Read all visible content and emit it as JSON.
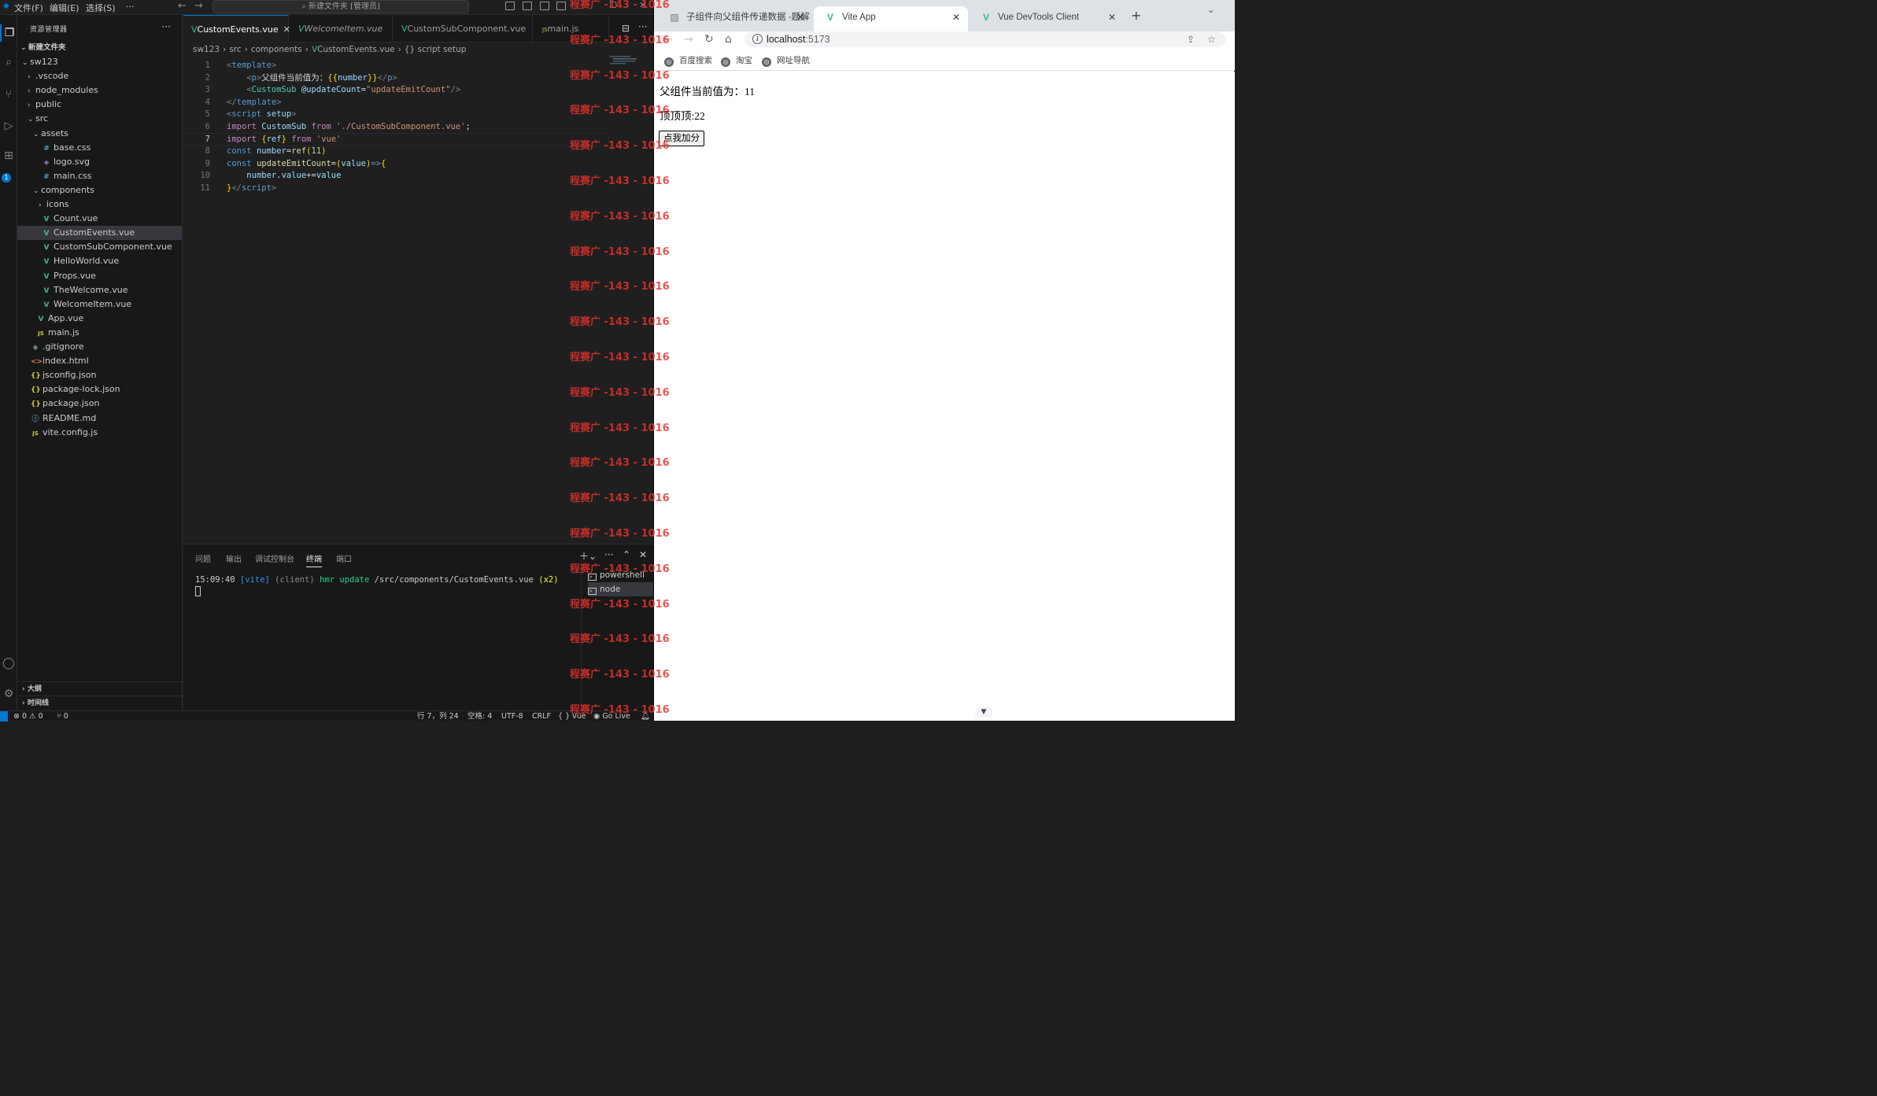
{
  "vscode": {
    "menu": [
      "文件(F)",
      "编辑(E)",
      "选择(S)",
      "···"
    ],
    "command_center": "新建文件夹 [管理员]",
    "sidebar": {
      "title": "资源管理器",
      "more": "···",
      "root": "新建文件夹",
      "tree": [
        {
          "label": "sw123",
          "type": "folder-open",
          "depth": 1
        },
        {
          "label": ".vscode",
          "type": "folder",
          "depth": 2
        },
        {
          "label": "node_modules",
          "type": "folder",
          "depth": 2
        },
        {
          "label": "public",
          "type": "folder",
          "depth": 2
        },
        {
          "label": "src",
          "type": "folder-open",
          "depth": 2
        },
        {
          "label": "assets",
          "type": "folder-open",
          "depth": 3
        },
        {
          "label": "base.css",
          "type": "css",
          "depth": 4
        },
        {
          "label": "logo.svg",
          "type": "svg",
          "depth": 4
        },
        {
          "label": "main.css",
          "type": "css",
          "depth": 4
        },
        {
          "label": "components",
          "type": "folder-open",
          "depth": 3
        },
        {
          "label": "icons",
          "type": "folder",
          "depth": 4
        },
        {
          "label": "Count.vue",
          "type": "vue",
          "depth": 4
        },
        {
          "label": "CustomEvents.vue",
          "type": "vue",
          "depth": 4,
          "selected": true
        },
        {
          "label": "CustomSubComponent.vue",
          "type": "vue",
          "depth": 4
        },
        {
          "label": "HelloWorld.vue",
          "type": "vue",
          "depth": 4
        },
        {
          "label": "Props.vue",
          "type": "vue",
          "depth": 4
        },
        {
          "label": "TheWelcome.vue",
          "type": "vue",
          "depth": 4
        },
        {
          "label": "WelcomeItem.vue",
          "type": "vue",
          "depth": 4
        },
        {
          "label": "App.vue",
          "type": "vue",
          "depth": 3
        },
        {
          "label": "main.js",
          "type": "js",
          "depth": 3
        },
        {
          "label": ".gitignore",
          "type": "git",
          "depth": 2
        },
        {
          "label": "index.html",
          "type": "html",
          "depth": 2
        },
        {
          "label": "jsconfig.json",
          "type": "json",
          "depth": 2
        },
        {
          "label": "package-lock.json",
          "type": "json",
          "depth": 2
        },
        {
          "label": "package.json",
          "type": "json",
          "depth": 2
        },
        {
          "label": "README.md",
          "type": "info",
          "depth": 2
        },
        {
          "label": "vite.config.js",
          "type": "js",
          "depth": 2
        }
      ],
      "outline": "大纲",
      "timeline": "时间线"
    },
    "activity_badge": "1",
    "tabs": [
      {
        "label": "CustomEvents.vue",
        "active": true,
        "close": "✕"
      },
      {
        "label": "WelcomeItem.vue",
        "italic": true
      },
      {
        "label": "CustomSubComponent.vue"
      },
      {
        "label": "main.js"
      }
    ],
    "breadcrumb": {
      "parts": [
        "sw123",
        "src",
        "components",
        "CustomEvents.vue",
        "{} script setup"
      ],
      "sep": "›"
    },
    "code_lines": [
      {
        "n": "1",
        "tokens": [
          [
            "k-punct",
            "<"
          ],
          [
            "k-tag",
            "template"
          ],
          [
            "k-punct",
            ">"
          ]
        ]
      },
      {
        "n": "2",
        "tokens": [
          [
            "k-plain",
            "    "
          ],
          [
            "k-punct",
            "<"
          ],
          [
            "k-tag",
            "p"
          ],
          [
            "k-punct",
            ">"
          ],
          [
            "k-text",
            "父组件当前值为："
          ],
          [
            "k-brace",
            "{{"
          ],
          [
            "k-var",
            "number"
          ],
          [
            "k-brace",
            "}}"
          ],
          [
            "k-punct",
            "</"
          ],
          [
            "k-tag",
            "p"
          ],
          [
            "k-punct",
            ">"
          ]
        ]
      },
      {
        "n": "3",
        "tokens": [
          [
            "k-plain",
            "    "
          ],
          [
            "k-punct",
            "<"
          ],
          [
            "k-tagname",
            "CustomSub"
          ],
          [
            "k-plain",
            " "
          ],
          [
            "k-attr",
            "@updateCount"
          ],
          [
            "k-plain",
            "="
          ],
          [
            "k-str",
            "\"updateEmitCount\""
          ],
          [
            "k-punct",
            "/>"
          ]
        ]
      },
      {
        "n": "4",
        "tokens": [
          [
            "k-punct",
            "</"
          ],
          [
            "k-tag",
            "template"
          ],
          [
            "k-punct",
            ">"
          ]
        ]
      },
      {
        "n": "5",
        "tokens": [
          [
            "k-punct",
            "<"
          ],
          [
            "k-tag",
            "script"
          ],
          [
            "k-plain",
            " "
          ],
          [
            "k-attr",
            "setup"
          ],
          [
            "k-punct",
            ">"
          ]
        ]
      },
      {
        "n": "6",
        "tokens": [
          [
            "k-kw",
            "import"
          ],
          [
            "k-plain",
            " "
          ],
          [
            "k-var",
            "CustomSub"
          ],
          [
            "k-plain",
            " "
          ],
          [
            "k-kw",
            "from"
          ],
          [
            "k-plain",
            " "
          ],
          [
            "k-str",
            "'./CustomSubComponent.vue'"
          ],
          [
            "k-plain",
            ";"
          ]
        ]
      },
      {
        "n": "7",
        "current": true,
        "tokens": [
          [
            "k-kw",
            "import"
          ],
          [
            "k-plain",
            " "
          ],
          [
            "k-brace",
            "{"
          ],
          [
            "k-var",
            "ref"
          ],
          [
            "k-brace",
            "}"
          ],
          [
            "k-plain",
            " "
          ],
          [
            "k-kw",
            "from"
          ],
          [
            "k-plain",
            " "
          ],
          [
            "k-str",
            "'vue'"
          ]
        ]
      },
      {
        "n": "8",
        "tokens": [
          [
            "k-decl",
            "const"
          ],
          [
            "k-plain",
            " "
          ],
          [
            "k-var",
            "number"
          ],
          [
            "k-plain",
            "="
          ],
          [
            "k-fn",
            "ref"
          ],
          [
            "k-brace",
            "("
          ],
          [
            "k-num",
            "11"
          ],
          [
            "k-brace",
            ")"
          ]
        ]
      },
      {
        "n": "9",
        "tokens": [
          [
            "k-decl",
            "const"
          ],
          [
            "k-plain",
            " "
          ],
          [
            "k-fn",
            "updateEmitCount"
          ],
          [
            "k-plain",
            "="
          ],
          [
            "k-brace",
            "("
          ],
          [
            "k-var",
            "value"
          ],
          [
            "k-brace",
            ")"
          ],
          [
            "k-decl",
            "=>"
          ],
          [
            "k-brace",
            "{"
          ]
        ]
      },
      {
        "n": "10",
        "tokens": [
          [
            "k-plain",
            "    "
          ],
          [
            "k-var",
            "number"
          ],
          [
            "k-plain",
            "."
          ],
          [
            "k-var",
            "value"
          ],
          [
            "k-plain",
            "+="
          ],
          [
            "k-var",
            "value"
          ]
        ]
      },
      {
        "n": "11",
        "tokens": [
          [
            "k-brace",
            "}"
          ],
          [
            "k-punct",
            "</"
          ],
          [
            "k-tag",
            "script"
          ],
          [
            "k-punct",
            ">"
          ]
        ]
      }
    ],
    "panel": {
      "tabs": [
        "问题",
        "输出",
        "调试控制台",
        "终端",
        "端口"
      ],
      "active_tab": "终端",
      "terminal": {
        "time": "15:09:40",
        "tag": "[vite]",
        "client": "(client)",
        "action": "hmr update",
        "path": "/src/components/CustomEvents.vue",
        "count": "(x2)"
      },
      "terminals": [
        "powershell",
        "node"
      ]
    },
    "statusbar": {
      "errors": "⊗ 0 ⚠ 0",
      "ports": "⑂ 0",
      "position": "行 7，列 24",
      "spaces": "空格: 4",
      "encoding": "UTF-8",
      "eol": "CRLF",
      "language": "{ } vue",
      "golive": "Go Live"
    }
  },
  "browser": {
    "tabs": [
      {
        "title": "子组件向父组件传递数据 -题解",
        "icon": "image-icon"
      },
      {
        "title": "Vite App",
        "icon": "vue-icon",
        "active": true
      },
      {
        "title": "Vue DevTools Client",
        "icon": "vue-icon"
      }
    ],
    "url_host": "localhost",
    "url_port": ":5173",
    "bookmarks": [
      "百度搜索",
      "淘宝",
      "网址导航"
    ],
    "page": {
      "line1": "父组件当前值为：11",
      "line2": "顶顶顶:22",
      "button": "点我加分"
    }
  },
  "watermark": "程赛广 -143 - 1016",
  "colors": {
    "accent": "#0078d4",
    "vue_green": "#41b883",
    "watermark": "#e5322d"
  }
}
